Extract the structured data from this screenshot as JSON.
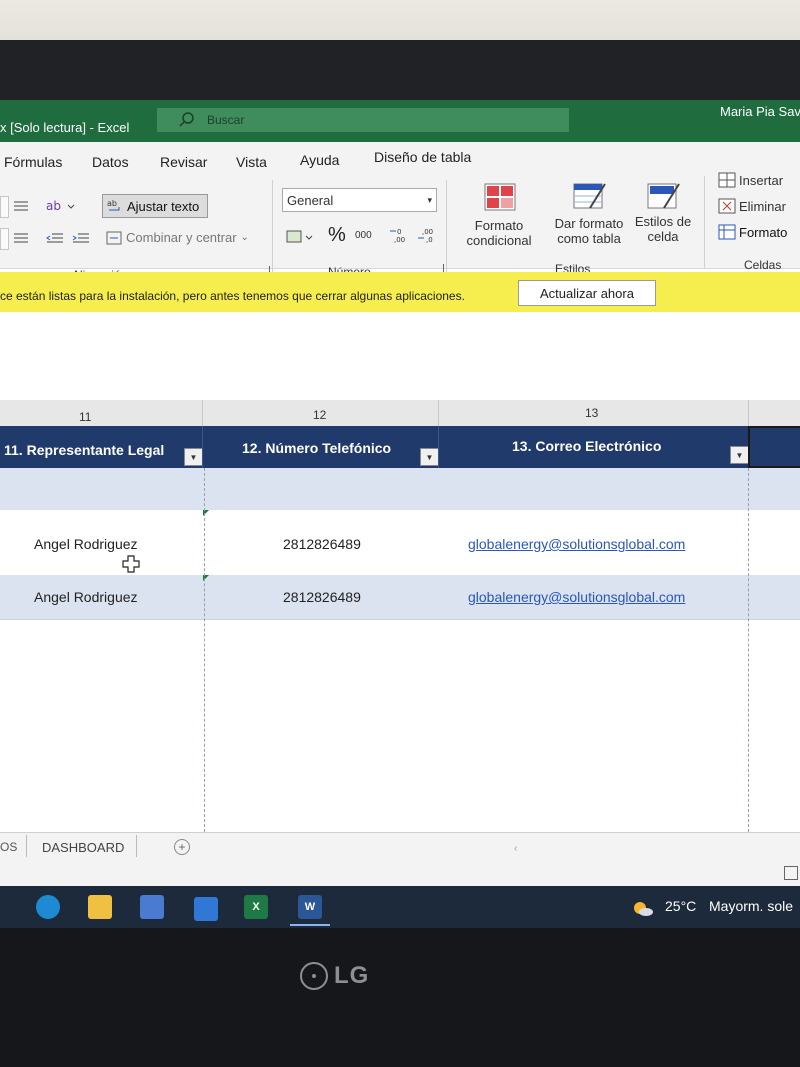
{
  "window": {
    "title": "x [Solo lectura] - Excel",
    "search_placeholder": "Buscar",
    "user": "Maria Pia Sav"
  },
  "menu": [
    "Fórmulas",
    "Datos",
    "Revisar",
    "Vista",
    "Ayuda",
    "Diseño de tabla"
  ],
  "ribbon": {
    "wrap_text": "Ajustar texto",
    "merge_center": "Combinar y centrar",
    "alignment_group": "Alineación",
    "number_format": "General",
    "percent": "%",
    "thousands": "000",
    "number_group": "Número",
    "conditional_format": [
      "Formato",
      "condicional"
    ],
    "format_as_table": [
      "Dar formato",
      "como tabla"
    ],
    "cell_styles": [
      "Estilos de",
      "celda"
    ],
    "styles_group": "Estilos",
    "insert": "Insertar",
    "delete": "Eliminar",
    "format": "Formato",
    "cells_group": "Celdas"
  },
  "message_bar": {
    "text": "ce están listas para la instalación, pero antes tenemos que cerrar algunas aplicaciones.",
    "button": "Actualizar ahora"
  },
  "columns": {
    "numbers": [
      "11",
      "12",
      "13"
    ],
    "headers": [
      "11. Representante Legal",
      "12. Número Telefónico",
      "13. Correo Electrónico"
    ]
  },
  "rows": [
    {
      "representative": "Angel Rodriguez",
      "phone": "2812826489",
      "email": "globalenergy@solutionsglobal.com"
    },
    {
      "representative": "Angel Rodriguez",
      "phone": "2812826489",
      "email": "globalenergy@solutionsglobal.com"
    }
  ],
  "sheet_tabs": {
    "partial": "OS",
    "active": "DASHBOARD"
  },
  "taskbar": {
    "temperature": "25°C",
    "weather": "Mayorm. sole"
  },
  "monitor": {
    "brand": "LG"
  },
  "colors": {
    "excel_green": "#1f6c3e",
    "table_header": "#1f3a6b",
    "band_row": "#dbe3f0",
    "message_bar": "#f6ee4e",
    "link": "#2b57b9"
  }
}
